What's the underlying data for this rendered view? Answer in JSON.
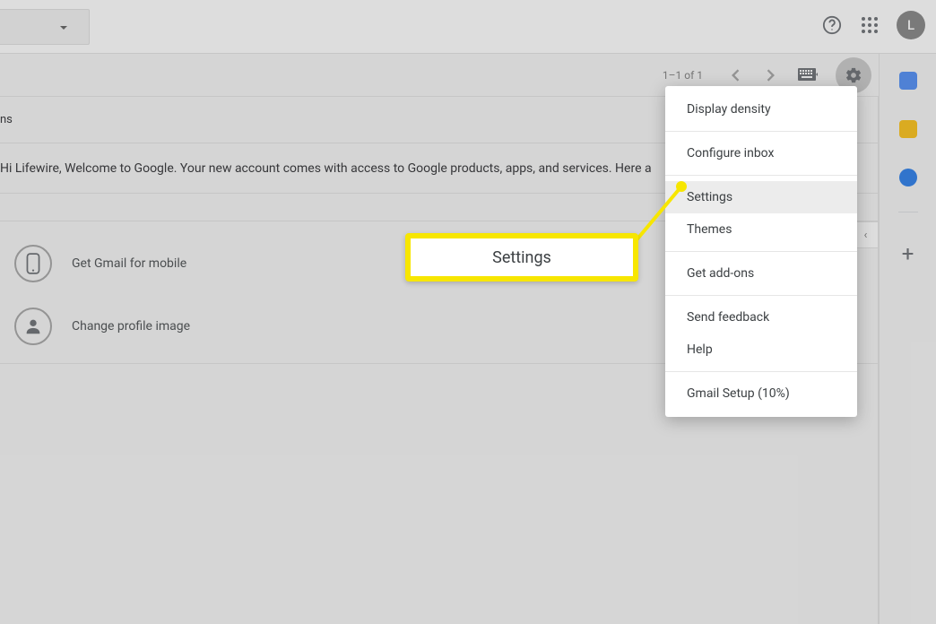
{
  "topbar": {
    "avatar_initial": "L"
  },
  "toolbar": {
    "page_count": "1–1 of 1"
  },
  "section": {
    "header": "ns"
  },
  "email": {
    "snippet": "Hi Lifewire, Welcome to Google. Your new account comes with access to Google products, apps, and services. Here a"
  },
  "cards": {
    "mobile": "Get Gmail for mobile",
    "profile": "Change profile image"
  },
  "menu": {
    "display_density": "Display density",
    "configure_inbox": "Configure inbox",
    "settings": "Settings",
    "themes": "Themes",
    "get_addons": "Get add-ons",
    "send_feedback": "Send feedback",
    "help": "Help",
    "gmail_setup": "Gmail Setup (10%)"
  },
  "callout": {
    "label": "Settings"
  },
  "collapse_glyph": "‹"
}
